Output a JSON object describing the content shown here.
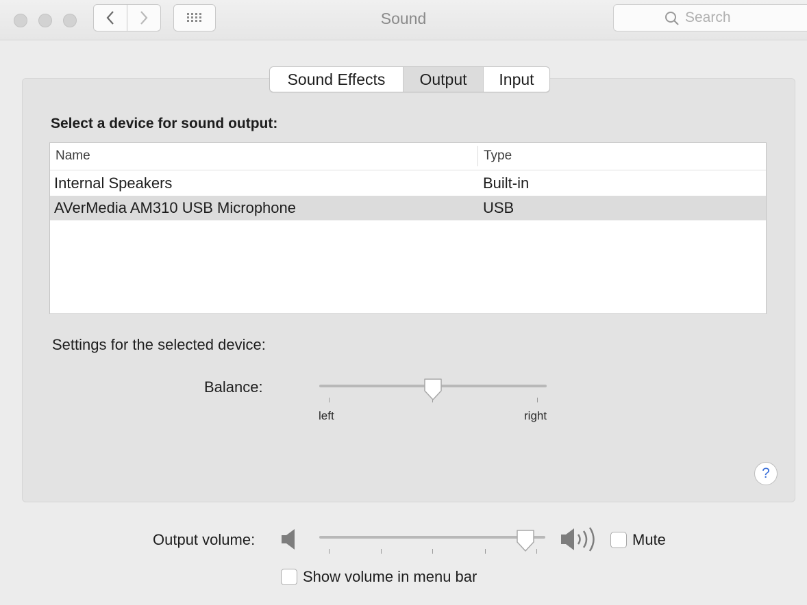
{
  "window": {
    "title": "Sound",
    "search_placeholder": "Search"
  },
  "tabs": [
    {
      "label": "Sound Effects",
      "selected": false
    },
    {
      "label": "Output",
      "selected": true
    },
    {
      "label": "Input",
      "selected": false
    }
  ],
  "output": {
    "heading": "Select a device for sound output:",
    "columns": {
      "name": "Name",
      "type": "Type"
    },
    "devices": [
      {
        "name": "Internal Speakers",
        "type": "Built-in",
        "selected": false
      },
      {
        "name": "AVerMedia AM310 USB Microphone",
        "type": "USB",
        "selected": true
      }
    ],
    "settings_heading": "Settings for the selected device:",
    "balance": {
      "label": "Balance:",
      "left_label": "left",
      "right_label": "right",
      "value": 0.5
    }
  },
  "help": {
    "label": "?"
  },
  "volume": {
    "label": "Output volume:",
    "value": 0.95,
    "mute_label": "Mute",
    "mute_checked": false,
    "show_in_menu_bar_label": "Show volume in menu bar",
    "show_in_menu_bar_checked": false
  },
  "colors": {
    "window_bg": "#ececec",
    "panel_bg": "#e3e3e3",
    "selected_row": "#dcdcdc",
    "help_accent": "#3a6fd8"
  }
}
